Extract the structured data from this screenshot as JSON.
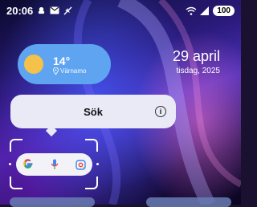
{
  "status_bar": {
    "time": "20:06",
    "left_icons": [
      "notification-icon",
      "mail-icon",
      "airplane-mode-icon"
    ],
    "right_icons": [
      "wifi-icon",
      "signal-icon"
    ],
    "battery": "100"
  },
  "weather_widget": {
    "temperature": "14°",
    "location": "Värnamo",
    "icon": "sun-icon"
  },
  "date_widget": {
    "date": "29 april",
    "weekday_year": "tisdag, 2025"
  },
  "search_popup": {
    "label": "Sök",
    "info_icon": "info-icon"
  },
  "google_widget": {
    "icons": [
      "google-icon",
      "microphone-icon",
      "lens-icon"
    ]
  },
  "colors": {
    "weather_bg": "#5ea4f0",
    "popup_bg": "#e9eaf5"
  }
}
